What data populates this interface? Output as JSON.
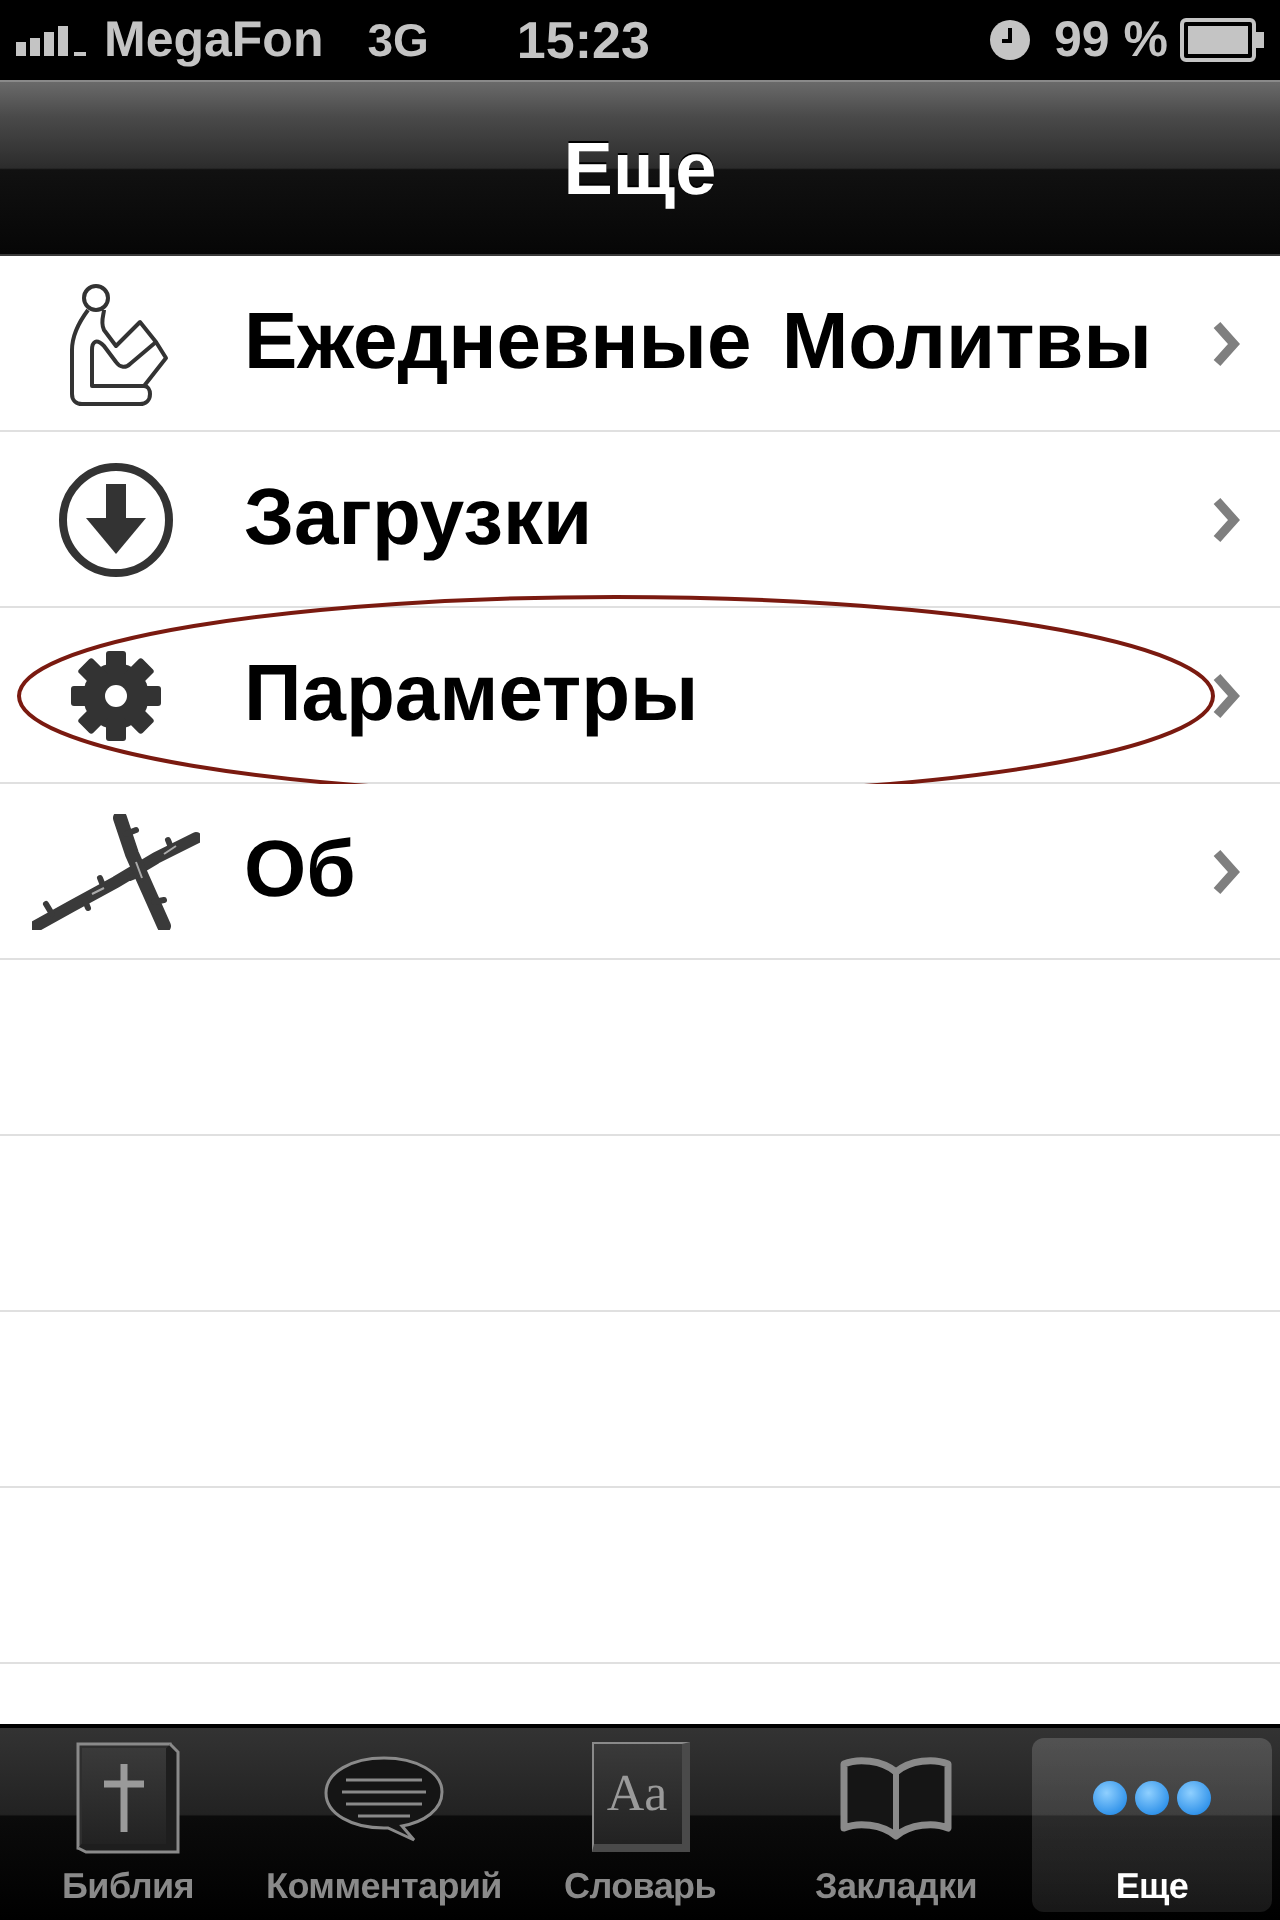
{
  "status_bar": {
    "carrier": "MegaFon",
    "network": "3G",
    "time": "15:23",
    "battery": "99 %"
  },
  "nav_bar": {
    "title": "Еще"
  },
  "menu": [
    {
      "label": "Ежедневные Молитвы",
      "circled": false
    },
    {
      "label": "Загрузки",
      "circled": false
    },
    {
      "label": "Параметры",
      "circled": true
    },
    {
      "label": "Об",
      "circled": false
    }
  ],
  "tab_bar": [
    {
      "label": "Библия",
      "selected": false
    },
    {
      "label": "Комментарий",
      "selected": false
    },
    {
      "label": "Словарь",
      "icon_text": "Aa",
      "selected": false
    },
    {
      "label": "Закладки",
      "selected": false
    },
    {
      "label": "Еще",
      "selected": true
    }
  ]
}
